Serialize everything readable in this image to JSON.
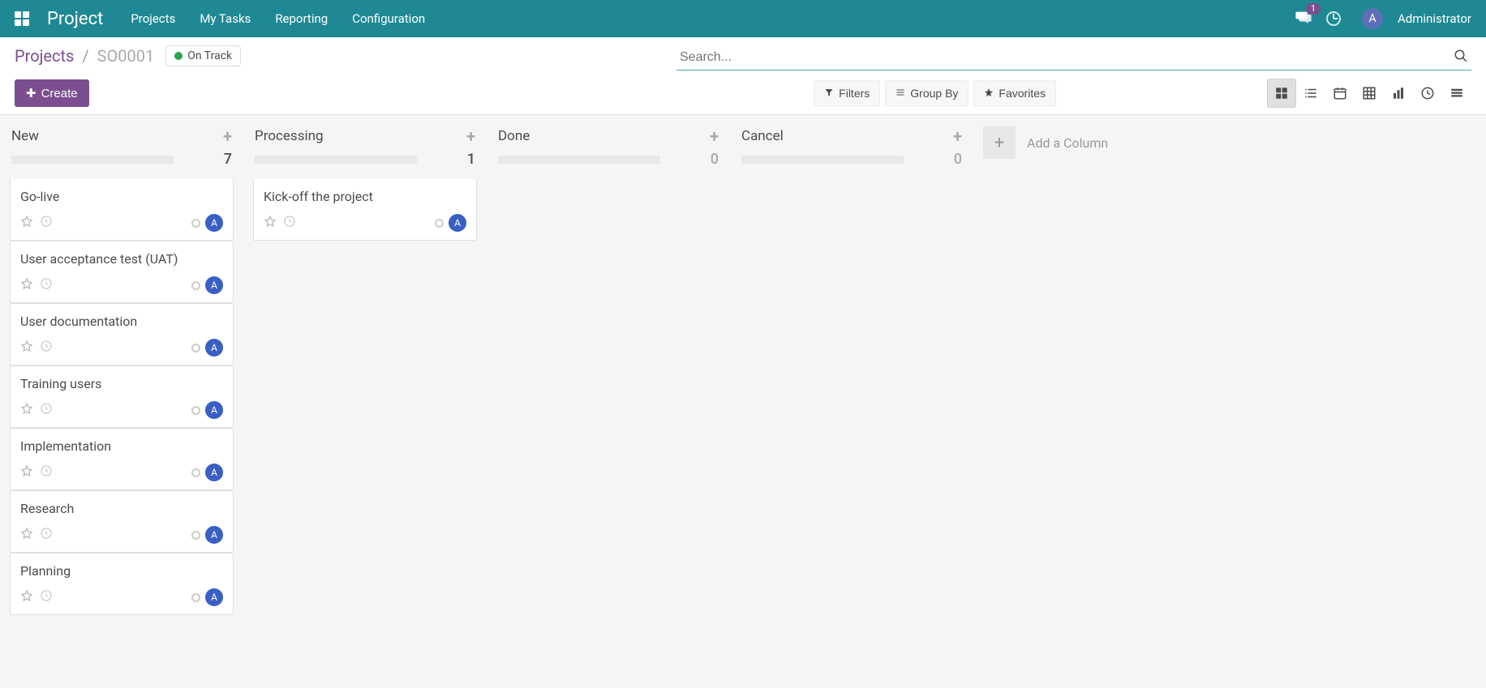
{
  "nav": {
    "brand": "Project",
    "links": [
      "Projects",
      "My Tasks",
      "Reporting",
      "Configuration"
    ],
    "msg_count": "1",
    "avatar_initial": "A",
    "username": "Administrator"
  },
  "breadcrumb": {
    "parent": "Projects",
    "sep": "/",
    "current": "SO0001"
  },
  "status": {
    "label": "On Track",
    "color": "#28a745"
  },
  "search": {
    "placeholder": "Search..."
  },
  "buttons": {
    "create": "Create",
    "filters": "Filters",
    "group_by": "Group By",
    "favorites": "Favorites",
    "add_column": "Add a Column"
  },
  "columns": [
    {
      "title": "New",
      "count": "7",
      "muted": false,
      "cards": [
        {
          "title": "Go-live",
          "avatar": "A"
        },
        {
          "title": "User acceptance test (UAT)",
          "avatar": "A"
        },
        {
          "title": "User documentation",
          "avatar": "A"
        },
        {
          "title": "Training users",
          "avatar": "A"
        },
        {
          "title": "Implementation",
          "avatar": "A"
        },
        {
          "title": "Research",
          "avatar": "A"
        },
        {
          "title": "Planning",
          "avatar": "A"
        }
      ]
    },
    {
      "title": "Processing",
      "count": "1",
      "muted": false,
      "cards": [
        {
          "title": "Kick-off the project",
          "avatar": "A"
        }
      ]
    },
    {
      "title": "Done",
      "count": "0",
      "muted": true,
      "cards": []
    },
    {
      "title": "Cancel",
      "count": "0",
      "muted": true,
      "cards": []
    }
  ]
}
